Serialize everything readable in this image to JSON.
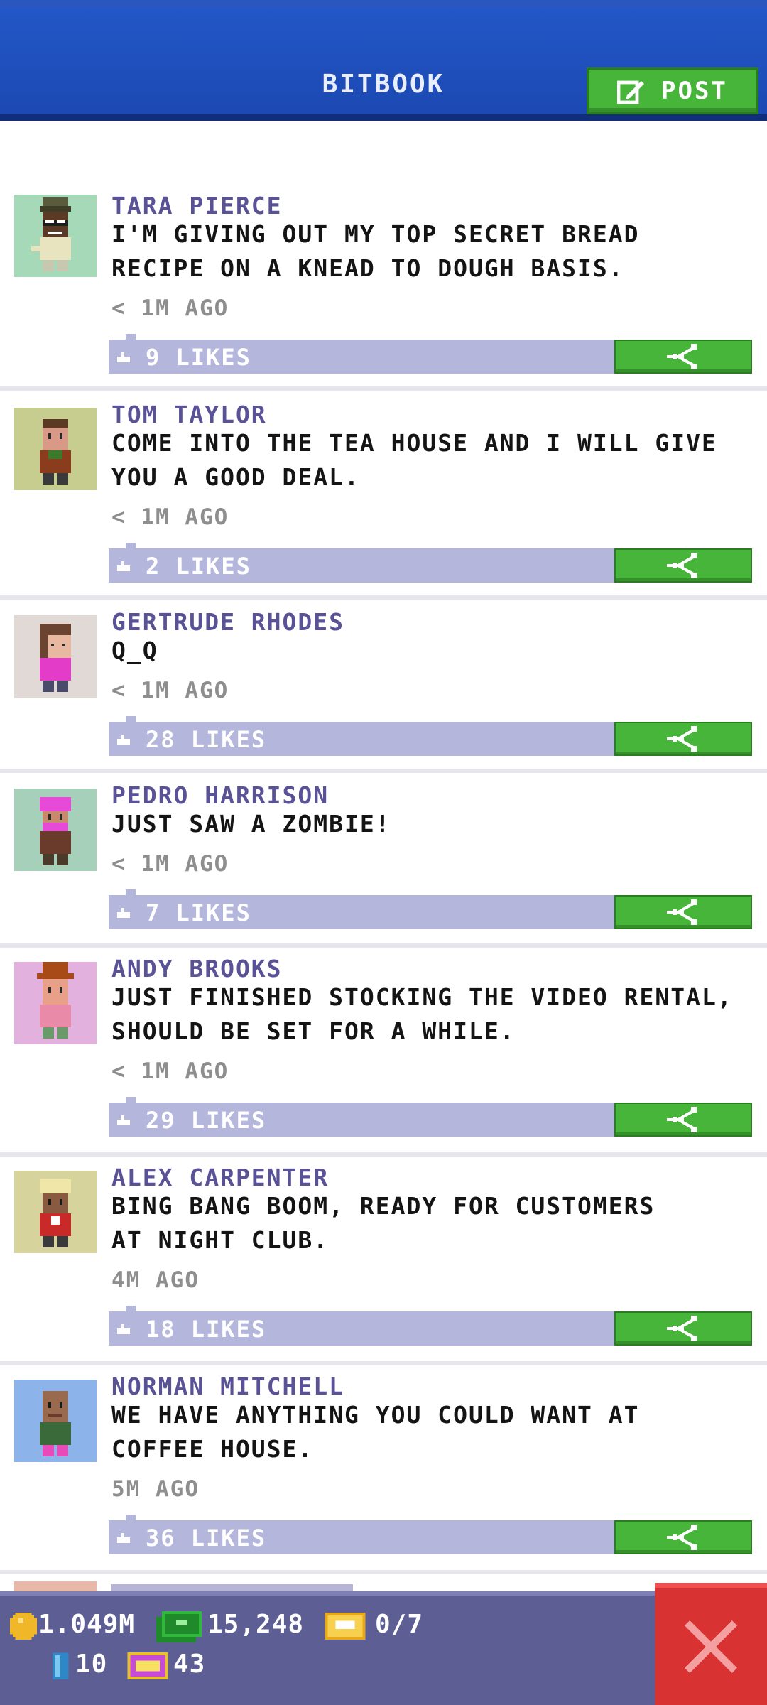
{
  "header": {
    "title": "BITBOOK",
    "post_label": "POST"
  },
  "posts": [
    {
      "name": "TARA PIERCE",
      "lines": [
        "I'M GIVING OUT MY TOP SECRET BREAD",
        "RECIPE ON A KNEAD TO DOUGH BASIS."
      ],
      "time": "< 1M AGO",
      "likes": "9 LIKES",
      "avatar_bg": "#a6d9b7"
    },
    {
      "name": "TOM TAYLOR",
      "lines": [
        "COME INTO THE TEA HOUSE AND I WILL GIVE",
        "YOU A GOOD DEAL."
      ],
      "time": "< 1M AGO",
      "likes": "2 LIKES",
      "avatar_bg": "#c6cd8f"
    },
    {
      "name": "GERTRUDE RHODES",
      "lines": [
        "Q_Q"
      ],
      "time": "< 1M AGO",
      "likes": "28 LIKES",
      "avatar_bg": "#e0d9d6"
    },
    {
      "name": "PEDRO HARRISON",
      "lines": [
        "JUST SAW A ZOMBIE!"
      ],
      "time": "< 1M AGO",
      "likes": "7 LIKES",
      "avatar_bg": "#a6d0b9"
    },
    {
      "name": "ANDY BROOKS",
      "lines": [
        "JUST FINISHED STOCKING THE VIDEO RENTAL,",
        "SHOULD BE SET FOR A WHILE."
      ],
      "time": "< 1M AGO",
      "likes": "29 LIKES",
      "avatar_bg": "#e2b1de"
    },
    {
      "name": "ALEX CARPENTER",
      "lines": [
        "BING BANG BOOM, READY FOR CUSTOMERS",
        "AT NIGHT CLUB."
      ],
      "time": "4M AGO",
      "likes": "18 LIKES",
      "avatar_bg": "#d6d49c"
    },
    {
      "name": "NORMAN MITCHELL",
      "lines": [
        "WE HAVE ANYTHING YOU COULD WANT AT",
        "COFFEE HOUSE."
      ],
      "time": "5M AGO",
      "likes": "36 LIKES",
      "avatar_bg": "#8cb4ea"
    }
  ],
  "status": {
    "coins": "1.049M",
    "bux": "15,248",
    "tickets": "0/7",
    "keys": "10",
    "vip": "43"
  },
  "colors": {
    "header_blue": "#1c49b3",
    "accent_green": "#47b43a",
    "name_purple": "#5a5296",
    "likes_bar": "#b4b6dc",
    "bottom_bar": "#5c5e94",
    "close_red": "#d83232"
  },
  "icons": {
    "post": "compose-icon",
    "like": "thumbs-up-icon",
    "share": "share-icon",
    "coin": "coin-icon",
    "bux": "bux-icon",
    "ticket": "ticket-icon",
    "key": "key-icon",
    "vip": "vip-icon",
    "close": "close-icon"
  }
}
